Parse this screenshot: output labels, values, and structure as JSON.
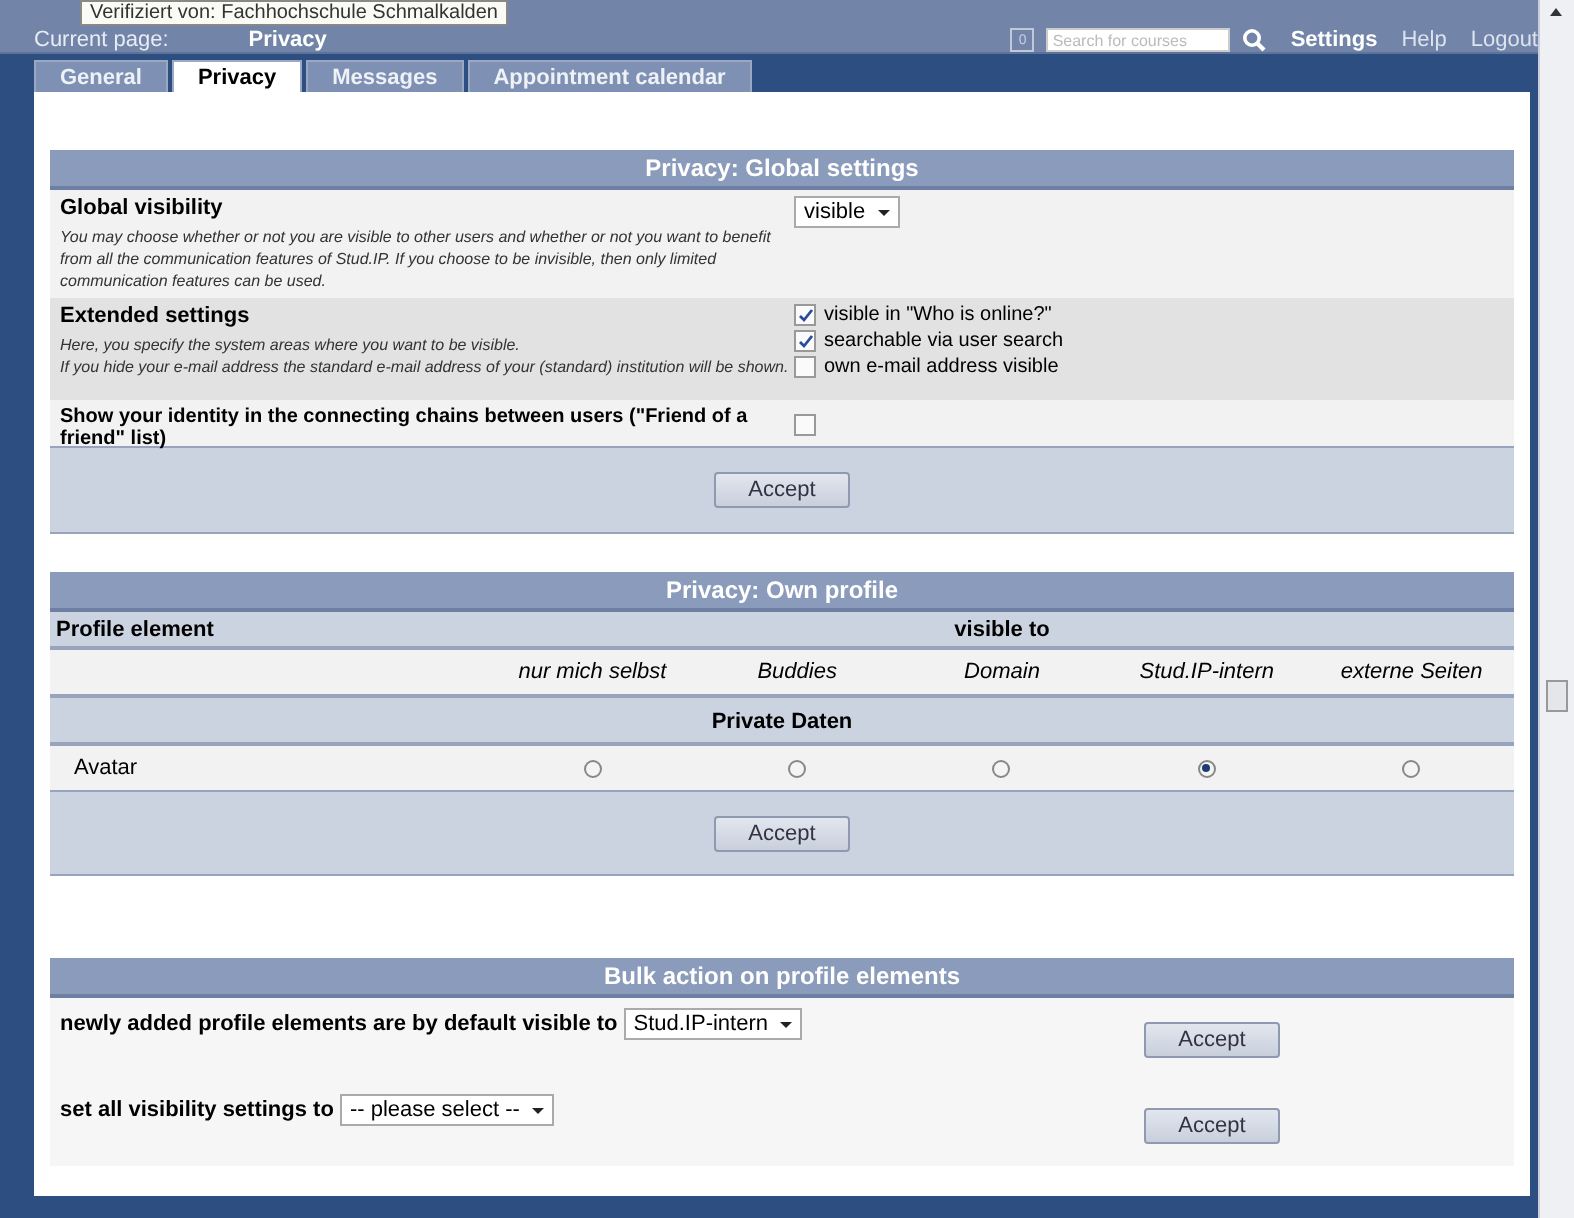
{
  "tooltip": "Verifiziert von: Fachhochschule Schmalkalden",
  "breadcrumb": {
    "label": "Current page:",
    "page": "Privacy"
  },
  "header": {
    "counter": "0",
    "search_placeholder": "Search for courses",
    "links": [
      {
        "label": "Settings",
        "selected": true
      },
      {
        "label": "Help",
        "selected": false
      },
      {
        "label": "Logout",
        "selected": false
      }
    ]
  },
  "tabs": [
    {
      "label": "General",
      "selected": false
    },
    {
      "label": "Privacy",
      "selected": true
    },
    {
      "label": "Messages",
      "selected": false
    },
    {
      "label": "Appointment calendar",
      "selected": false
    }
  ],
  "global_settings": {
    "title": "Privacy: Global settings",
    "rows": [
      {
        "kind": "select",
        "label": "Global visibility",
        "description": "You may choose whether or not you are visible to other users and whether or not you want to benefit from all the communication features of Stud.IP. If you choose to be invisible, then only limited communication features can be used.",
        "value": "visible"
      },
      {
        "kind": "checklist",
        "label": "Extended settings",
        "description": "Here, you specify the system areas where you want to be visible.\nIf you hide your e-mail address the standard e-mail address of your (standard) institution will be shown.",
        "options": [
          {
            "label": "visible in \"Who is online?\"",
            "checked": true
          },
          {
            "label": "searchable via user search",
            "checked": true
          },
          {
            "label": "own e-mail address visible",
            "checked": false
          }
        ]
      },
      {
        "kind": "checkbox",
        "label": "Show your identity in the connecting chains between users (\"Friend of a friend\" list)",
        "checked": false
      }
    ],
    "button": "Accept"
  },
  "own_profile": {
    "title": "Privacy: Own profile",
    "first_column": "Profile element",
    "group_column": "visible to",
    "levels": [
      "nur mich selbst",
      "Buddies",
      "Domain",
      "Stud.IP-intern",
      "externe Seiten"
    ],
    "groups": [
      {
        "title": "Private Daten",
        "rows": [
          {
            "label": "Avatar",
            "choices": [
              {
                "selected": false
              },
              {
                "selected": false
              },
              {
                "selected": false
              },
              {
                "selected": true
              },
              {
                "selected": false
              }
            ]
          }
        ]
      }
    ],
    "button": "Accept"
  },
  "bulk_action": {
    "title": "Bulk action on profile elements",
    "rows": [
      {
        "label": "newly added profile elements are by default visible to",
        "value": "Stud.IP-intern",
        "button": "Accept"
      },
      {
        "label": "set all visibility settings to",
        "value": "-- please select --",
        "button": "Accept"
      }
    ]
  }
}
